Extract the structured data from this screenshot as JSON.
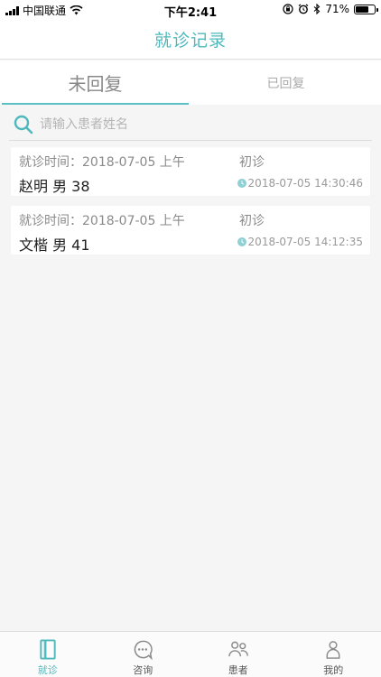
{
  "status_bar": {
    "carrier": "中国联通",
    "time": "下午2:41",
    "battery": "71%",
    "battery_level": 0.71
  },
  "navbar": {
    "title": "就诊记录"
  },
  "tabs": [
    {
      "label": "未回复",
      "active": true
    },
    {
      "label": "已回复",
      "active": false
    }
  ],
  "search": {
    "placeholder": "请输入患者姓名",
    "value": ""
  },
  "records": [
    {
      "visit_time": "就诊时间：2018-07-05 上午",
      "visit_type": "初诊",
      "patient": "赵明 男 38",
      "created": "2018-07-05 14:30:46"
    },
    {
      "visit_time": "就诊时间：2018-07-05 上午",
      "visit_type": "初诊",
      "patient": "文楷 男 41",
      "created": "2018-07-05 14:12:35"
    }
  ],
  "tabbar": [
    {
      "label": "就诊",
      "icon": "clinic-icon",
      "active": true
    },
    {
      "label": "咨询",
      "icon": "chat-icon",
      "active": false
    },
    {
      "label": "患者",
      "icon": "patients-icon",
      "active": false
    },
    {
      "label": "我的",
      "icon": "profile-icon",
      "active": false
    }
  ],
  "colors": {
    "accent": "#4fb8bd",
    "background": "#f5f5f5",
    "inactive_icon": "#8a8a8a"
  }
}
